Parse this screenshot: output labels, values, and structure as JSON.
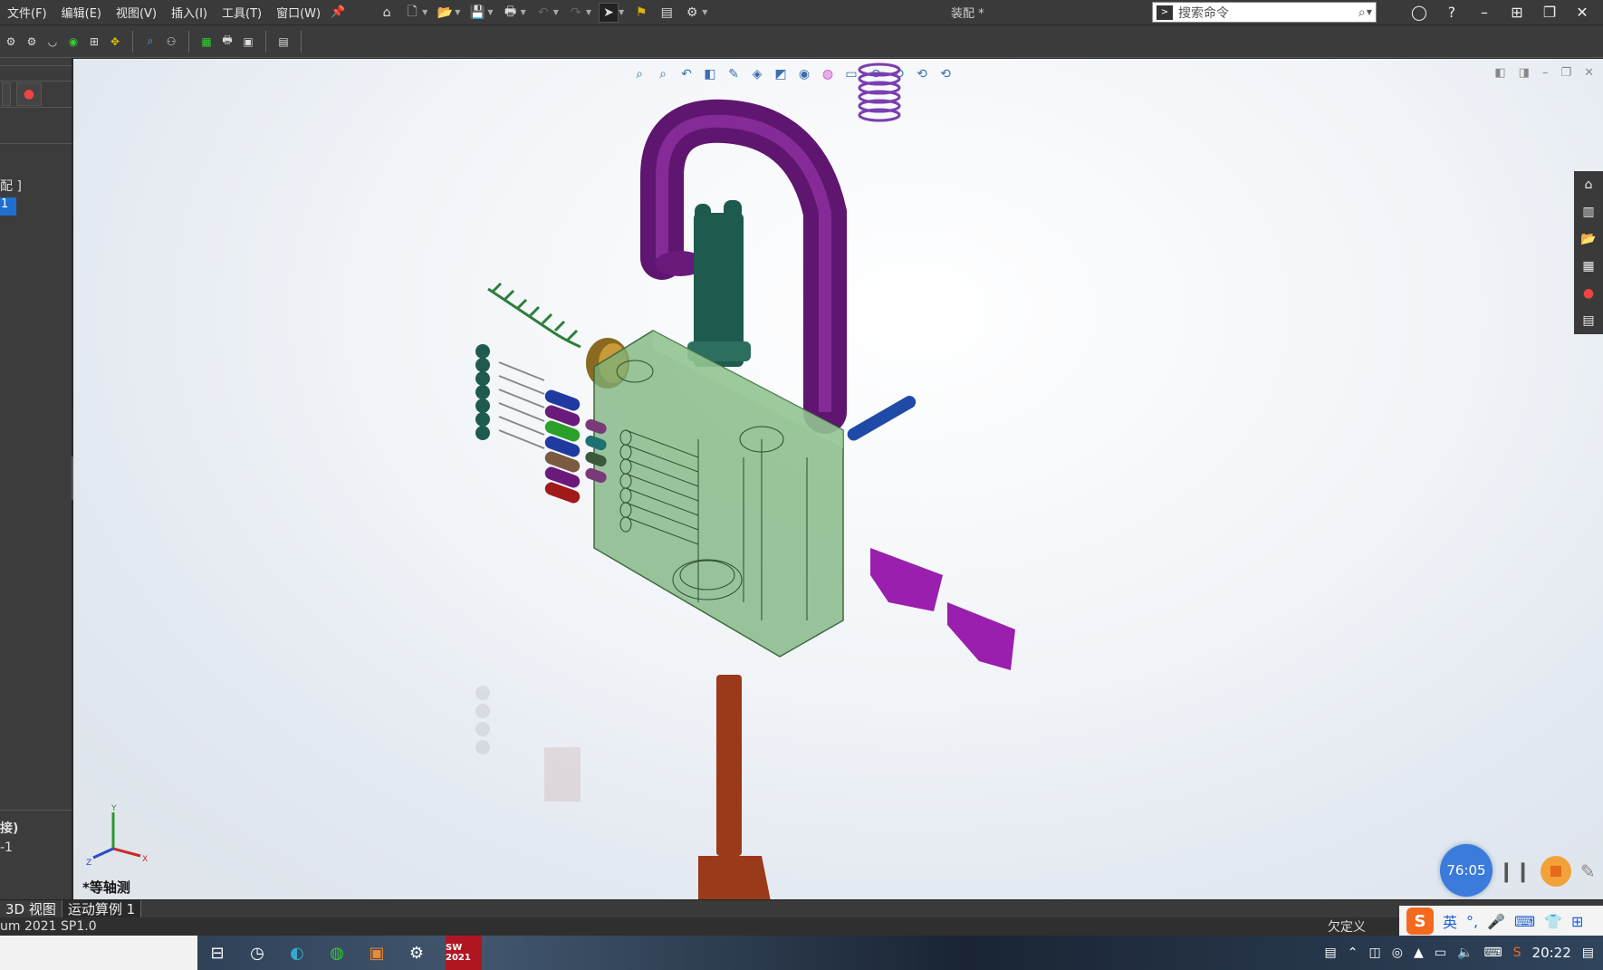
{
  "menu": [
    "文件(F)",
    "编辑(E)",
    "视图(V)",
    "插入(I)",
    "工具(T)",
    "窗口(W)"
  ],
  "document_title": "装配 *",
  "search": {
    "placeholder": "搜索命令"
  },
  "left_panel": {
    "text1": "配 ]",
    "selected": "1",
    "text2": "接)",
    "text3": "-1"
  },
  "viewport": {
    "view_label": "*等轴测",
    "triad_axes": [
      "Y",
      "Z",
      "X"
    ]
  },
  "bottom_tabs": [
    "3D 视图",
    "运动算例 1"
  ],
  "status": {
    "version": "um 2021 SP1.0",
    "state": "欠定义"
  },
  "recorder": {
    "timer": "76:05"
  },
  "ime": {
    "lang": "英",
    "brand": "S"
  },
  "taskbar": {
    "sw_badge": "SW 2021",
    "clock": "20:22"
  },
  "colors": {
    "shackle": "#6b1a7a",
    "body": "#7ab27a",
    "key": "#a0431f",
    "accent": "#1f6fd1"
  }
}
